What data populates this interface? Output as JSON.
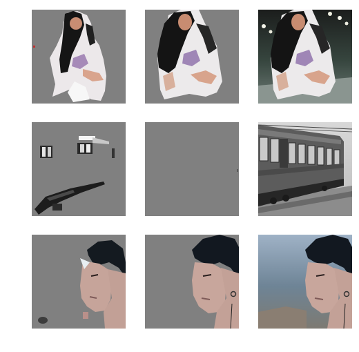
{
  "grid": {
    "rows": 3,
    "cols": 3,
    "background_color": "#808080",
    "tiles": [
      [
        {
          "content": "woman-outstretched-hand",
          "variant": "partial-mask"
        },
        {
          "content": "woman-outstretched-hand",
          "variant": "segmented-mask"
        },
        {
          "content": "woman-outstretched-hand",
          "variant": "original-photo"
        }
      ],
      [
        {
          "content": "vintage-train-car",
          "variant": "partial-mask"
        },
        {
          "content": "vintage-train-car",
          "variant": "empty-mask"
        },
        {
          "content": "vintage-train-car",
          "variant": "original-photo"
        }
      ],
      [
        {
          "content": "woman-portrait-profile",
          "variant": "partial-mask"
        },
        {
          "content": "woman-portrait-profile",
          "variant": "segmented-mask"
        },
        {
          "content": "woman-portrait-profile",
          "variant": "original-photo"
        }
      ]
    ]
  }
}
